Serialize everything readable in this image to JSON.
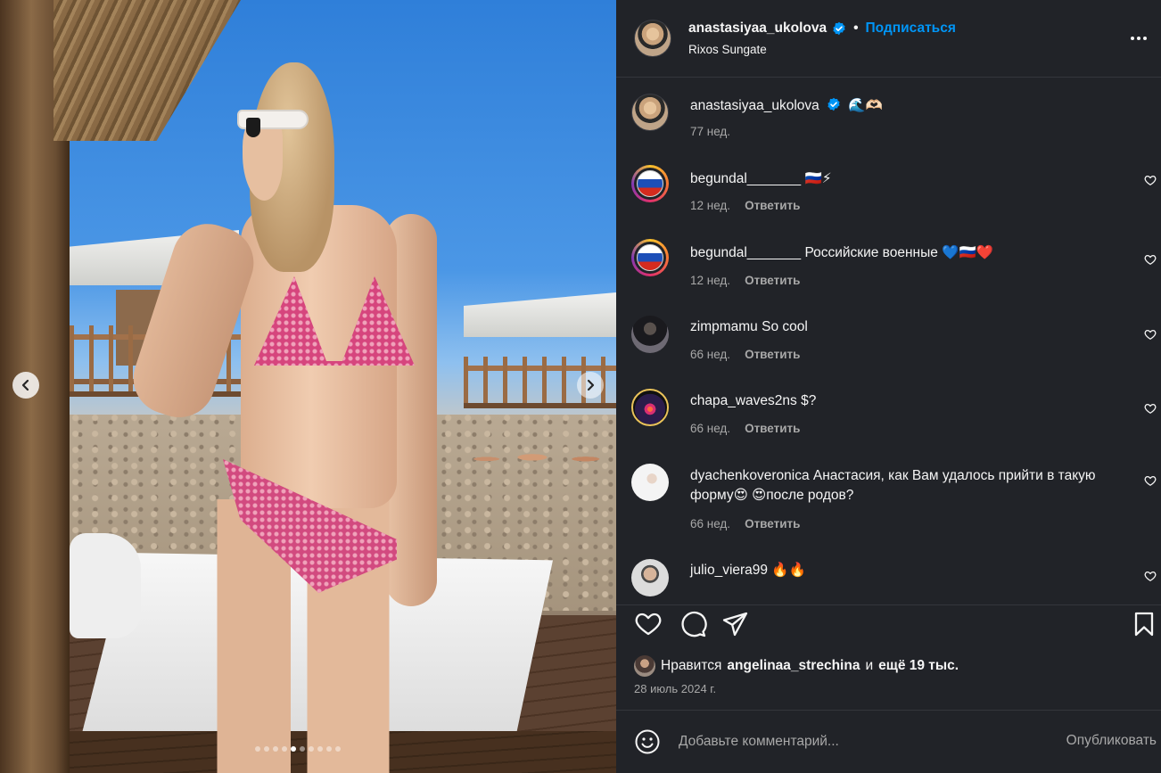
{
  "header": {
    "username": "anastasiyaa_ukolova",
    "follow_label": "Подписаться",
    "location": "Rixos Sungate",
    "separator": "•"
  },
  "caption": {
    "username": "anastasiyaa_ukolova",
    "text": "🌊🫶🏻",
    "time": "77 нед."
  },
  "comments": [
    {
      "username": "begundal_______",
      "text": "🇷🇺⚡",
      "time": "12 нед.",
      "reply": "Ответить"
    },
    {
      "username": "begundal_______",
      "text": "Российские военные 💙🇷🇺❤️",
      "time": "12 нед.",
      "reply": "Ответить"
    },
    {
      "username": "zimpmamu",
      "text": "So cool",
      "time": "66 нед.",
      "reply": "Ответить"
    },
    {
      "username": "chapa_waves2ns",
      "text": "$?",
      "time": "66 нед.",
      "reply": "Ответить"
    },
    {
      "username": "dyachenkoveronica",
      "text": "Анастасия, как Вам удалось прийти в такую форму😍 😍после родов?",
      "time": "66 нед.",
      "reply": "Ответить"
    },
    {
      "username": "julio_viera99",
      "text": "🔥🔥"
    }
  ],
  "likes": {
    "prefix": "Нравится",
    "user": "angelinaa_strechina",
    "middle": "и",
    "count": "ещё 19 тыс."
  },
  "date": "28 июль 2024 г.",
  "composer": {
    "placeholder": "Добавьте комментарий...",
    "publish_label": "Опубликовать"
  },
  "carousel": {
    "total": 10,
    "active_index": 4
  },
  "colors": {
    "accent": "#0095f6",
    "background": "#212328",
    "muted": "#a8a8a8"
  }
}
